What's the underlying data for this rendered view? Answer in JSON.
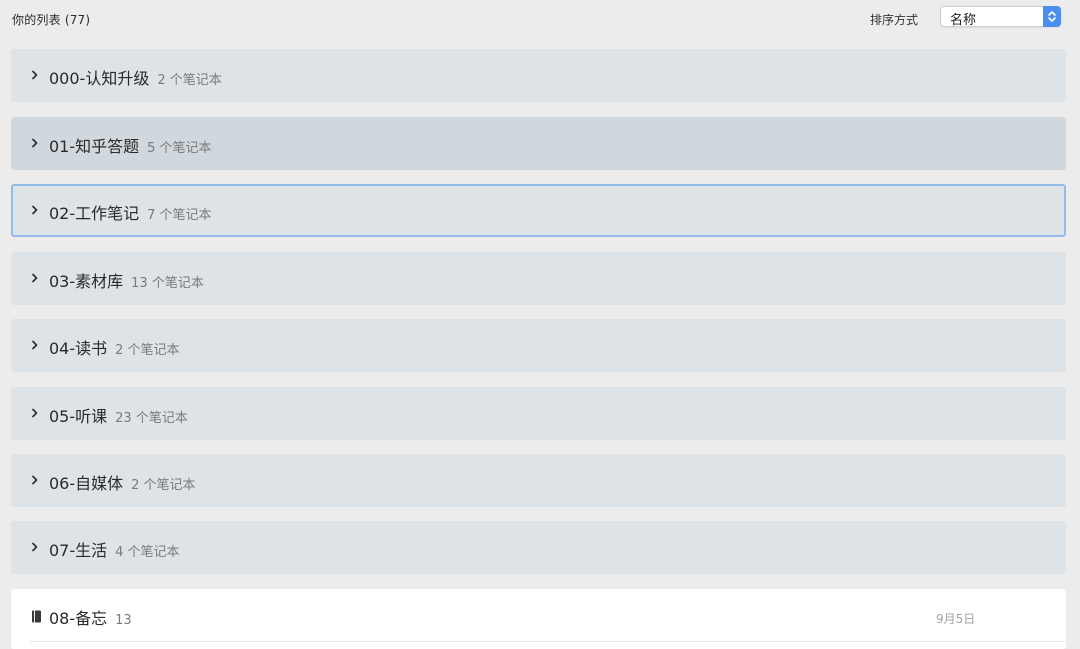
{
  "header": {
    "list_title": "你的列表 (77)",
    "sort_label": "排序方式",
    "sort_value": "名称",
    "accent_color": "#4a8ef0"
  },
  "stacks": [
    {
      "name": "000-认知升级",
      "count": "2 个笔记本"
    },
    {
      "name": "01-知乎答题",
      "count": "5 个笔记本"
    },
    {
      "name": "02-工作笔记",
      "count": "7 个笔记本"
    },
    {
      "name": "03-素材库",
      "count": "13 个笔记本"
    },
    {
      "name": "04-读书",
      "count": "2 个笔记本"
    },
    {
      "name": "05-听课",
      "count": "23 个笔记本"
    },
    {
      "name": "06-自媒体",
      "count": "2 个笔记本"
    },
    {
      "name": "07-生活",
      "count": "4 个笔记本"
    }
  ],
  "notebook": {
    "name": "08-备忘",
    "count": "13",
    "date": "9月5日",
    "icon": "notebook-icon"
  },
  "icons": {
    "stack_expand": "chevron-right-icon",
    "sort_stepper": "up-down-chevron-icon"
  }
}
